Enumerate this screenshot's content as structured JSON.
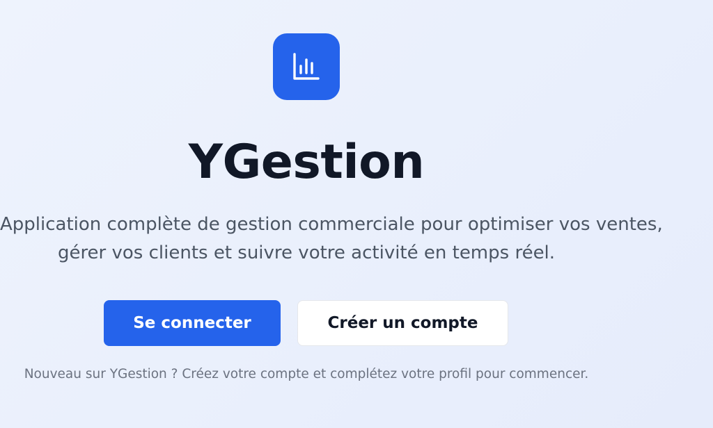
{
  "app": {
    "title": "YGestion",
    "logo_icon": "bar-chart-icon",
    "accent_color": "#2563eb"
  },
  "tagline": {
    "line1": "Application complète de gestion commerciale pour optimiser vos ventes,",
    "line2": "gérer vos clients et suivre votre activité en temps réel."
  },
  "actions": {
    "login_label": "Se connecter",
    "register_label": "Créer un compte"
  },
  "hint": "Nouveau sur YGestion ? Créez votre compte et complétez votre profil pour commencer."
}
